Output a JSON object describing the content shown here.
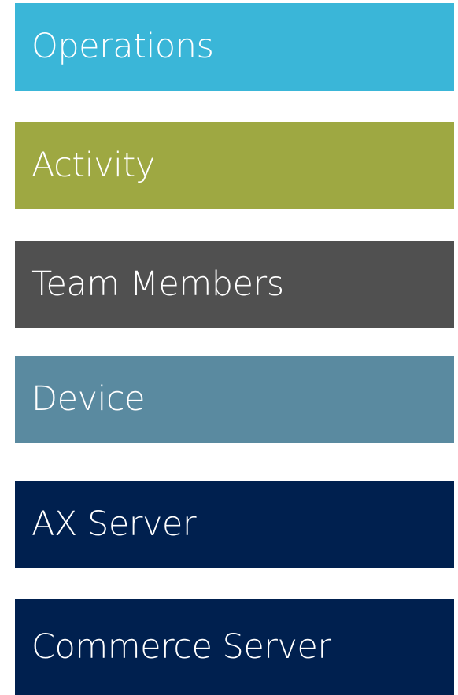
{
  "tiles": [
    {
      "label": "Operations",
      "color": "#3ab6d8"
    },
    {
      "label": "Activity",
      "color": "#9ea842"
    },
    {
      "label": "Team Members",
      "color": "#505050"
    },
    {
      "label": "Device",
      "color": "#5a8aa0"
    },
    {
      "label": "AX Server",
      "color": "#00204f"
    },
    {
      "label": "Commerce Server",
      "color": "#00204f"
    }
  ]
}
